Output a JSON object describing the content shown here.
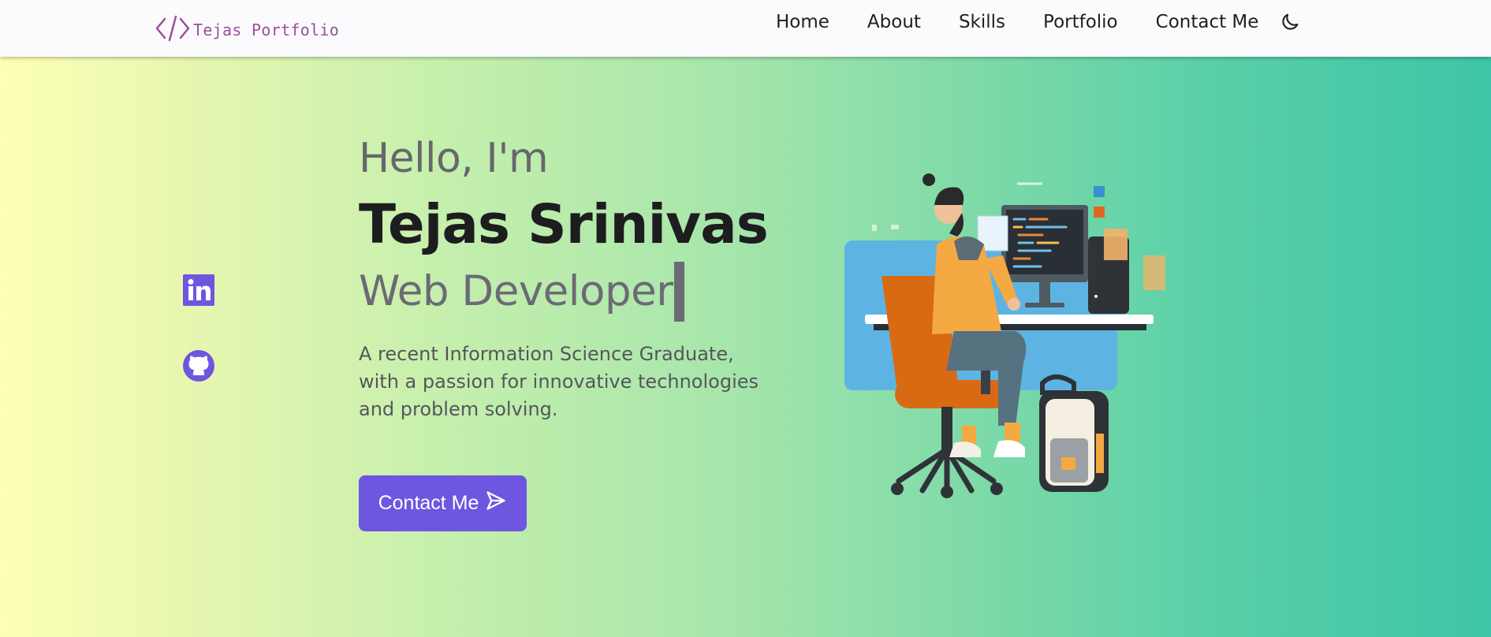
{
  "navbar": {
    "brand": {
      "icon": "code-brackets-icon",
      "name": "Tejas Portfolio",
      "color": "#9b4f9b"
    },
    "links": [
      {
        "label": "Home"
      },
      {
        "label": "About"
      },
      {
        "label": "Skills"
      },
      {
        "label": "Portfolio"
      },
      {
        "label": "Contact Me"
      }
    ],
    "theme_toggle_icon": "moon-icon"
  },
  "socials": [
    {
      "icon": "linkedin-icon",
      "color": "#6e56e0"
    },
    {
      "icon": "github-icon",
      "color": "#6e56e0"
    }
  ],
  "hero": {
    "greeting": "Hello, I'm",
    "name": "Tejas Srinivas",
    "role": "Web Developer",
    "bio": "A recent Information Science Graduate, with a passion for innovative technologies and problem solving.",
    "cta_label": "Contact Me",
    "cta_icon": "send-icon",
    "accent_color": "#6e56e0"
  },
  "illustration": {
    "icon": "developer-at-desk-illustration"
  }
}
